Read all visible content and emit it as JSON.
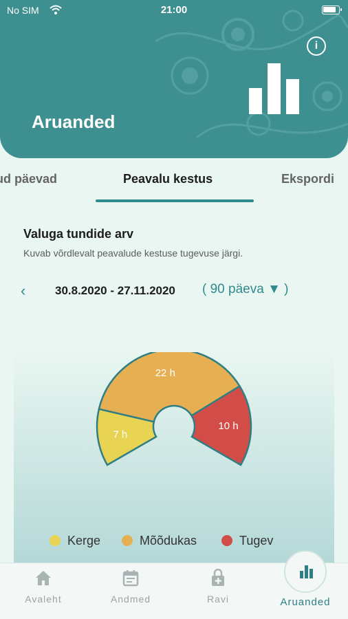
{
  "status_bar": {
    "carrier": "No SIM",
    "time": "21:00"
  },
  "header": {
    "title": "Aruanded",
    "info_icon": "info-icon",
    "report_icon": "bar-chart-icon"
  },
  "tabs": [
    {
      "label": "ud päevad",
      "active": false
    },
    {
      "label": "Peavalu kestus",
      "active": true
    },
    {
      "label": "Ekspordi",
      "active": false
    }
  ],
  "section": {
    "title": "Valuga tundide arv",
    "subtitle": "Kuvab võrdlevalt peavalude kestuse tugevuse järgi."
  },
  "date_range": {
    "prev_icon": "chevron-left-icon",
    "range": "30.8.2020 - 27.11.2020",
    "period": "( 90 päeva ▼ )"
  },
  "chart_data": {
    "type": "pie",
    "slices": [
      {
        "label": "Kerge",
        "value": 7,
        "display": "7 h",
        "color": "#e8d353"
      },
      {
        "label": "Mõõdukas",
        "value": 22,
        "display": "22 h",
        "color": "#e6b052"
      },
      {
        "label": "Tugev",
        "value": 10,
        "display": "10 h",
        "color": "#d24d47"
      }
    ],
    "legend_position": "bottom"
  },
  "legend": [
    {
      "label": "Kerge",
      "color": "#e8d353"
    },
    {
      "label": "Mõõdukas",
      "color": "#e6b052"
    },
    {
      "label": "Tugev",
      "color": "#d24d47"
    }
  ],
  "tab_bar": [
    {
      "label": "Avaleht",
      "icon": "home-icon",
      "active": false
    },
    {
      "label": "Andmed",
      "icon": "calendar-icon",
      "active": false
    },
    {
      "label": "Ravi",
      "icon": "first-aid-icon",
      "active": false
    },
    {
      "label": "Aruanded",
      "icon": "bar-chart-icon",
      "active": true
    }
  ],
  "colors": {
    "accent": "#3e8f8f",
    "background": "#e9f6f1"
  }
}
